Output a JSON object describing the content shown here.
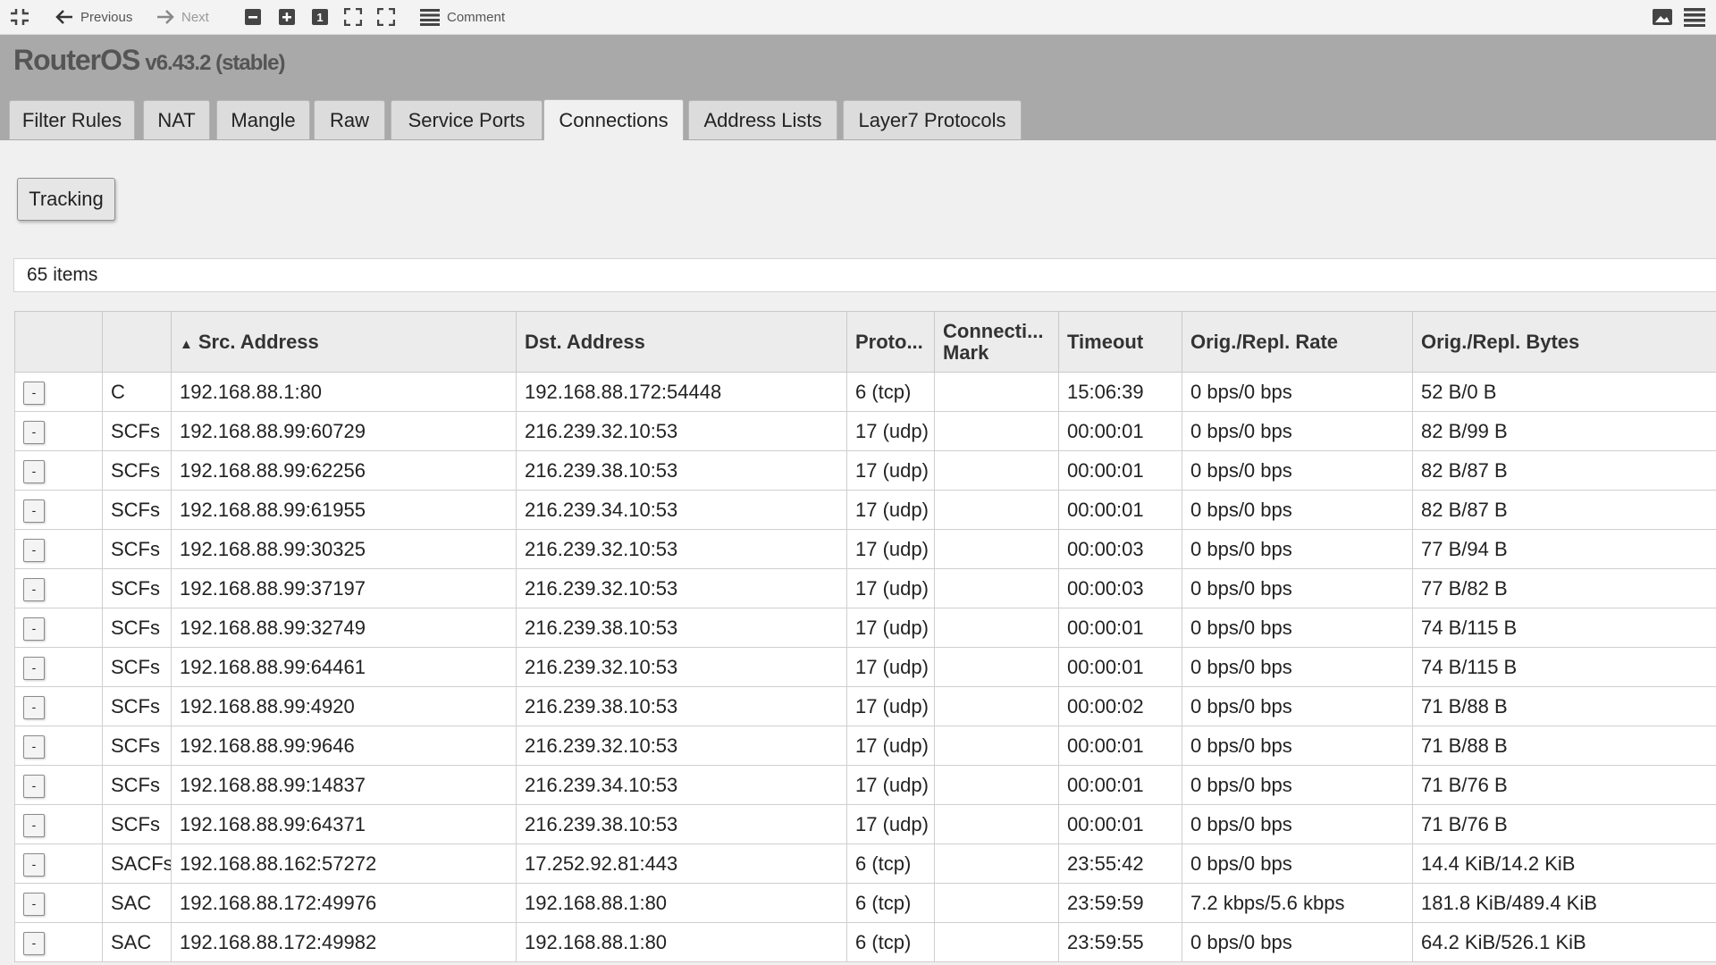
{
  "toolbar": {
    "previous_label": "Previous",
    "next_label": "Next",
    "comment_label": "Comment"
  },
  "header": {
    "app_name": "RouterOS",
    "version": "v6.43.2 (stable)"
  },
  "tabs": [
    {
      "label": "Filter Rules"
    },
    {
      "label": "NAT"
    },
    {
      "label": "Mangle"
    },
    {
      "label": "Raw"
    },
    {
      "label": "Service Ports"
    },
    {
      "label": "Connections",
      "active": true
    },
    {
      "label": "Address Lists"
    },
    {
      "label": "Layer7 Protocols"
    }
  ],
  "tracking_button": "Tracking",
  "items_count": "65 items",
  "table": {
    "columns": {
      "src": "Src. Address",
      "dst": "Dst. Address",
      "proto": "Proto...",
      "mark_line1": "Connecti...",
      "mark_line2": "Mark",
      "timeout": "Timeout",
      "rate": "Orig./Repl. Rate",
      "bytes": "Orig./Repl. Bytes"
    },
    "sort_indicator": "▲",
    "row_button_label": "-",
    "rows": [
      {
        "flags": "C",
        "src": "192.168.88.1:80",
        "dst": "192.168.88.172:54448",
        "proto": "6 (tcp)",
        "mark": "",
        "timeout": "15:06:39",
        "rate": "0 bps/0 bps",
        "bytes": "52 B/0 B"
      },
      {
        "flags": "SCFs",
        "src": "192.168.88.99:60729",
        "dst": "216.239.32.10:53",
        "proto": "17 (udp)",
        "mark": "",
        "timeout": "00:00:01",
        "rate": "0 bps/0 bps",
        "bytes": "82 B/99 B"
      },
      {
        "flags": "SCFs",
        "src": "192.168.88.99:62256",
        "dst": "216.239.38.10:53",
        "proto": "17 (udp)",
        "mark": "",
        "timeout": "00:00:01",
        "rate": "0 bps/0 bps",
        "bytes": "82 B/87 B"
      },
      {
        "flags": "SCFs",
        "src": "192.168.88.99:61955",
        "dst": "216.239.34.10:53",
        "proto": "17 (udp)",
        "mark": "",
        "timeout": "00:00:01",
        "rate": "0 bps/0 bps",
        "bytes": "82 B/87 B"
      },
      {
        "flags": "SCFs",
        "src": "192.168.88.99:30325",
        "dst": "216.239.32.10:53",
        "proto": "17 (udp)",
        "mark": "",
        "timeout": "00:00:03",
        "rate": "0 bps/0 bps",
        "bytes": "77 B/94 B"
      },
      {
        "flags": "SCFs",
        "src": "192.168.88.99:37197",
        "dst": "216.239.32.10:53",
        "proto": "17 (udp)",
        "mark": "",
        "timeout": "00:00:03",
        "rate": "0 bps/0 bps",
        "bytes": "77 B/82 B"
      },
      {
        "flags": "SCFs",
        "src": "192.168.88.99:32749",
        "dst": "216.239.38.10:53",
        "proto": "17 (udp)",
        "mark": "",
        "timeout": "00:00:01",
        "rate": "0 bps/0 bps",
        "bytes": "74 B/115 B"
      },
      {
        "flags": "SCFs",
        "src": "192.168.88.99:64461",
        "dst": "216.239.32.10:53",
        "proto": "17 (udp)",
        "mark": "",
        "timeout": "00:00:01",
        "rate": "0 bps/0 bps",
        "bytes": "74 B/115 B"
      },
      {
        "flags": "SCFs",
        "src": "192.168.88.99:4920",
        "dst": "216.239.38.10:53",
        "proto": "17 (udp)",
        "mark": "",
        "timeout": "00:00:02",
        "rate": "0 bps/0 bps",
        "bytes": "71 B/88 B"
      },
      {
        "flags": "SCFs",
        "src": "192.168.88.99:9646",
        "dst": "216.239.32.10:53",
        "proto": "17 (udp)",
        "mark": "",
        "timeout": "00:00:01",
        "rate": "0 bps/0 bps",
        "bytes": "71 B/88 B"
      },
      {
        "flags": "SCFs",
        "src": "192.168.88.99:14837",
        "dst": "216.239.34.10:53",
        "proto": "17 (udp)",
        "mark": "",
        "timeout": "00:00:01",
        "rate": "0 bps/0 bps",
        "bytes": "71 B/76 B"
      },
      {
        "flags": "SCFs",
        "src": "192.168.88.99:64371",
        "dst": "216.239.38.10:53",
        "proto": "17 (udp)",
        "mark": "",
        "timeout": "00:00:01",
        "rate": "0 bps/0 bps",
        "bytes": "71 B/76 B"
      },
      {
        "flags": "SACFs",
        "src": "192.168.88.162:57272",
        "dst": "17.252.92.81:443",
        "proto": "6 (tcp)",
        "mark": "",
        "timeout": "23:55:42",
        "rate": "0 bps/0 bps",
        "bytes": "14.4 KiB/14.2 KiB"
      },
      {
        "flags": "SAC",
        "src": "192.168.88.172:49976",
        "dst": "192.168.88.1:80",
        "proto": "6 (tcp)",
        "mark": "",
        "timeout": "23:59:59",
        "rate": "7.2 kbps/5.6 kbps",
        "bytes": "181.8 KiB/489.4 KiB"
      },
      {
        "flags": "SAC",
        "src": "192.168.88.172:49982",
        "dst": "192.168.88.1:80",
        "proto": "6 (tcp)",
        "mark": "",
        "timeout": "23:59:55",
        "rate": "0 bps/0 bps",
        "bytes": "64.2 KiB/526.1 KiB"
      }
    ]
  }
}
